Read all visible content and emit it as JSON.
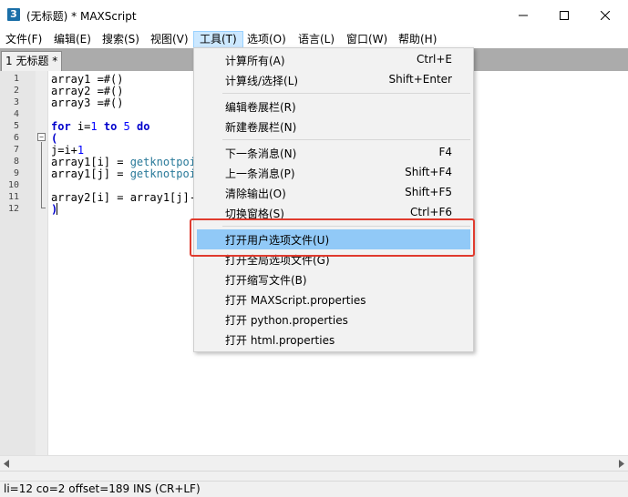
{
  "window": {
    "title": "(无标题) * MAXScript",
    "icon_text": "3"
  },
  "menubar": {
    "items": [
      "文件(F)",
      "编辑(E)",
      "搜索(S)",
      "视图(V)",
      "工具(T)",
      "选项(O)",
      "语言(L)",
      "窗口(W)",
      "帮助(H)"
    ],
    "active": "工具(T)"
  },
  "tabs": [
    {
      "label": "1 无标题 *"
    }
  ],
  "editor": {
    "line_numbers": [
      "1",
      "2",
      "3",
      "4",
      "5",
      "6",
      "7",
      "8",
      "9",
      "10",
      "11",
      "12"
    ],
    "lines": {
      "l1a": "array1 =#()",
      "l2a": "array2 =#()",
      "l3a": "array3 =#()",
      "l5_kw1": "for",
      "l5_mid": " i=",
      "l5_n1": "1",
      "l5_sp": " ",
      "l5_kw2": "to",
      "l5_sp2": " ",
      "l5_n2": "5",
      "l5_sp3": " ",
      "l5_kw3": "do",
      "l6": "(",
      "l7a": "j=i+",
      "l7n": "1",
      "l8a": "array1[i] = ",
      "l8f": "getknotpoi",
      "l9a": "array1[j] = ",
      "l9f": "getknotpoi",
      "l11a": "array2[i] = array1[j]-",
      "l12": ")"
    }
  },
  "tools_menu": {
    "items": [
      {
        "label": "计算所有(A)",
        "shortcut": "Ctrl+E"
      },
      {
        "label": "计算线/选择(L)",
        "shortcut": "Shift+Enter"
      },
      {
        "label": "编辑卷展栏(R)",
        "shortcut": ""
      },
      {
        "label": "新建卷展栏(N)",
        "shortcut": ""
      },
      {
        "label": "下一条消息(N)",
        "shortcut": "F4"
      },
      {
        "label": "上一条消息(P)",
        "shortcut": "Shift+F4"
      },
      {
        "label": "清除输出(O)",
        "shortcut": "Shift+F5"
      },
      {
        "label": "切换窗格(S)",
        "shortcut": "Ctrl+F6"
      },
      {
        "label": "打开用户选项文件(U)",
        "shortcut": ""
      },
      {
        "label": "打开全局选项文件(G)",
        "shortcut": ""
      },
      {
        "label": "打开缩写文件(B)",
        "shortcut": ""
      },
      {
        "label": "打开 MAXScript.properties",
        "shortcut": ""
      },
      {
        "label": "打开 python.properties",
        "shortcut": ""
      },
      {
        "label": "打开 html.properties",
        "shortcut": ""
      }
    ],
    "highlighted": "打开用户选项文件(U)"
  },
  "statusbar": {
    "text": "li=12 co=2 offset=189 INS (CR+LF)"
  },
  "colors": {
    "keyword": "#0000cc",
    "highlight": "#91c9f7",
    "annotation_box": "#e03b2e"
  }
}
